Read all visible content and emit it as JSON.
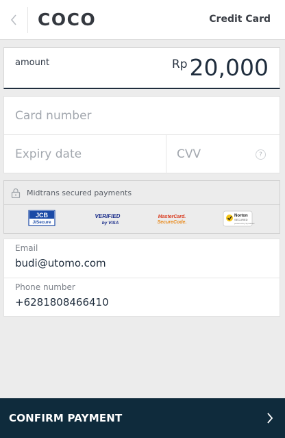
{
  "header": {
    "merchant_name": "COCO",
    "payment_method": "Credit Card",
    "back_icon": "chevron-left-icon"
  },
  "amount": {
    "label": "amount",
    "currency": "Rp",
    "value": "20,000"
  },
  "card_form": {
    "card_number_placeholder": "Card number",
    "card_number_value": "",
    "expiry_placeholder": "Expiry date",
    "expiry_value": "",
    "cvv_placeholder": "CVV",
    "cvv_value": "",
    "cvv_help": "?"
  },
  "secure": {
    "text": "Midtrans secured payments",
    "lock_icon": "lock-icon",
    "logos": {
      "jcb_top": "JCB",
      "jcb_bottom": "J/Secure",
      "visa_top": "VERIFIED",
      "visa_bottom": "by VISA",
      "mc_top": "MasterCard.",
      "mc_bottom": "SecureCode.",
      "norton_top": "Norton",
      "norton_mid": "SECURED",
      "norton_bottom": "powered by Symantec"
    }
  },
  "contact": {
    "email_label": "Email",
    "email_value": "budi@utomo.com",
    "phone_label": "Phone number",
    "phone_value": "+6281808466410"
  },
  "confirm": {
    "label": "CONFIRM PAYMENT",
    "icon": "chevron-right-icon"
  },
  "colors": {
    "confirm_bg": "#0f2b3c",
    "amount_underline": "#1f2d3d",
    "background": "#ececec"
  }
}
